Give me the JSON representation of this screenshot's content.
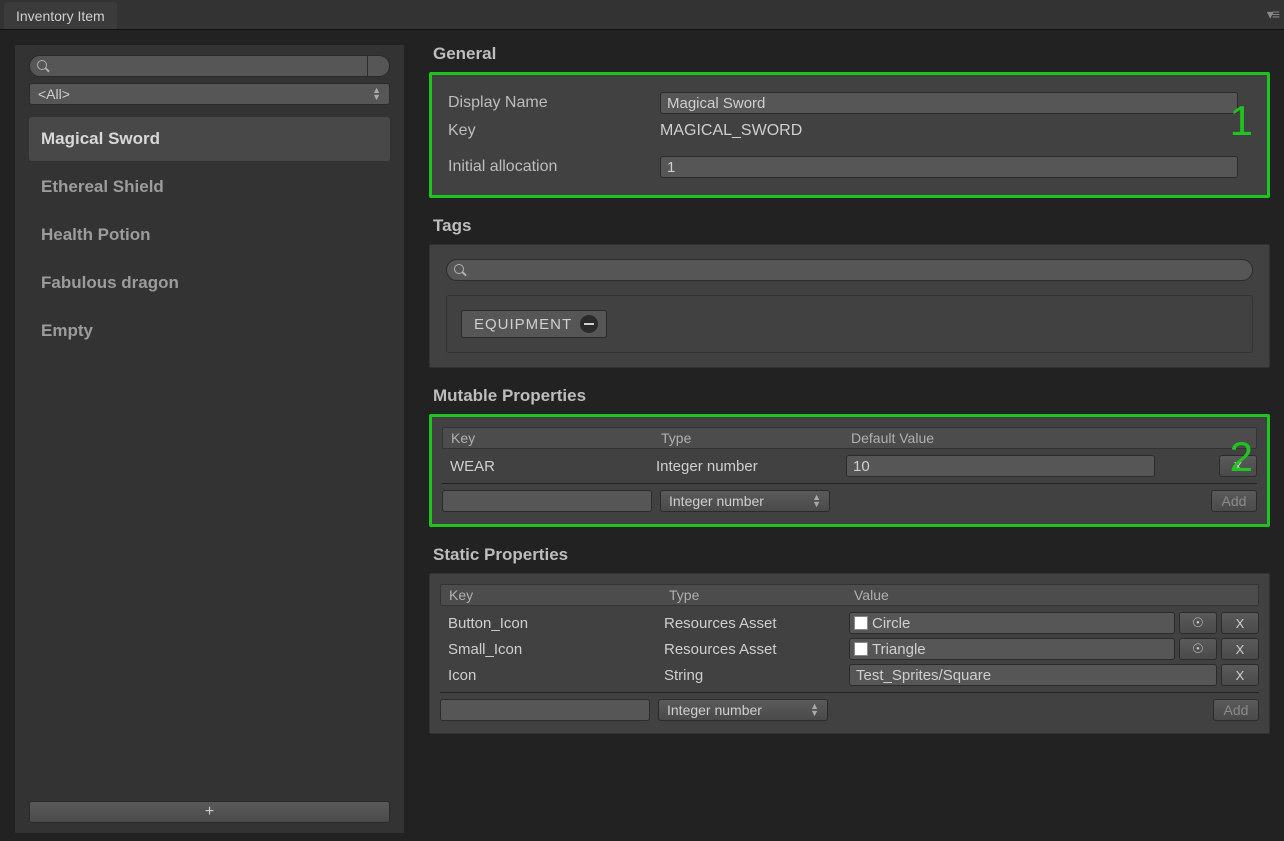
{
  "tab": {
    "title": "Inventory Item"
  },
  "sidebar": {
    "filter": "<All>",
    "items": [
      {
        "label": "Magical Sword",
        "selected": true
      },
      {
        "label": "Ethereal Shield",
        "selected": false
      },
      {
        "label": "Health Potion",
        "selected": false
      },
      {
        "label": "Fabulous dragon",
        "selected": false
      },
      {
        "label": "Empty",
        "selected": false
      }
    ],
    "add_label": "+"
  },
  "general": {
    "title": "General",
    "display_name_label": "Display Name",
    "display_name_value": "Magical Sword",
    "key_label": "Key",
    "key_value": "MAGICAL_SWORD",
    "initial_alloc_label": "Initial allocation",
    "initial_alloc_value": "1",
    "highlight_number": "1"
  },
  "tags": {
    "title": "Tags",
    "chips": [
      {
        "label": "EQUIPMENT"
      }
    ]
  },
  "mutable": {
    "title": "Mutable Properties",
    "highlight_number": "2",
    "headers": {
      "key": "Key",
      "type": "Type",
      "value": "Default Value"
    },
    "rows": [
      {
        "key": "WEAR",
        "type": "Integer number",
        "value": "10",
        "remove": "X"
      }
    ],
    "new_type": "Integer number",
    "add_label": "Add"
  },
  "static": {
    "title": "Static Properties",
    "headers": {
      "key": "Key",
      "type": "Type",
      "value": "Value"
    },
    "rows": [
      {
        "key": "Button_Icon",
        "type": "Resources Asset",
        "value": "Circle",
        "asset": true,
        "picker": "☉",
        "remove": "X"
      },
      {
        "key": "Small_Icon",
        "type": "Resources Asset",
        "value": "Triangle",
        "asset": true,
        "picker": "☉",
        "remove": "X"
      },
      {
        "key": "Icon",
        "type": "String",
        "value": "Test_Sprites/Square",
        "asset": false,
        "remove": "X"
      }
    ],
    "new_type": "Integer number",
    "add_label": "Add"
  }
}
